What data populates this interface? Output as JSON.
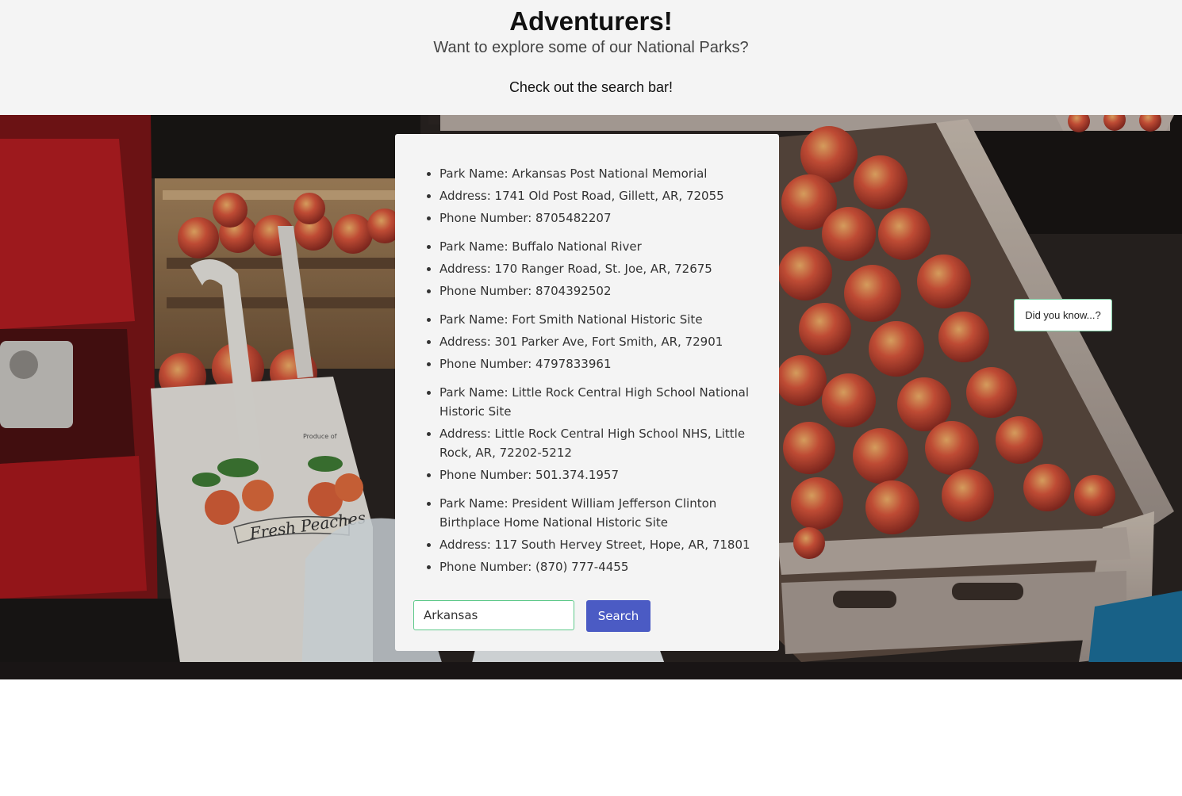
{
  "header": {
    "title": "Adventurers!",
    "subtitle": "Want to explore some of our National Parks?",
    "hint": "Check out the search bar!"
  },
  "parks": [
    {
      "name": "Park Name: Arkansas Post National Memorial",
      "address": "Address: 1741 Old Post Road, Gillett, AR, 72055",
      "phone": "Phone Number: 8705482207"
    },
    {
      "name": "Park Name: Buffalo National River",
      "address": "Address: 170 Ranger Road, St. Joe, AR, 72675",
      "phone": "Phone Number: 8704392502"
    },
    {
      "name": "Park Name: Fort Smith National Historic Site",
      "address": "Address: 301 Parker Ave, Fort Smith, AR, 72901",
      "phone": "Phone Number: 4797833961"
    },
    {
      "name": "Park Name: Little Rock Central High School National Historic Site",
      "address": "Address: Little Rock Central High School NHS, Little Rock, AR, 72202-5212",
      "phone": "Phone Number: 501.374.1957"
    },
    {
      "name": "Park Name: President William Jefferson Clinton Birthplace Home National Historic Site",
      "address": "Address: 117 South Hervey Street, Hope, AR, 71801",
      "phone": "Phone Number: (870) 777-4455"
    }
  ],
  "search": {
    "value": "Arkansas",
    "button_label": "Search"
  },
  "fact_button": {
    "label": "Did you know...?"
  },
  "background_image": {
    "bag_text": "Fresh Peaches",
    "bag_small_text": "Produce of"
  }
}
